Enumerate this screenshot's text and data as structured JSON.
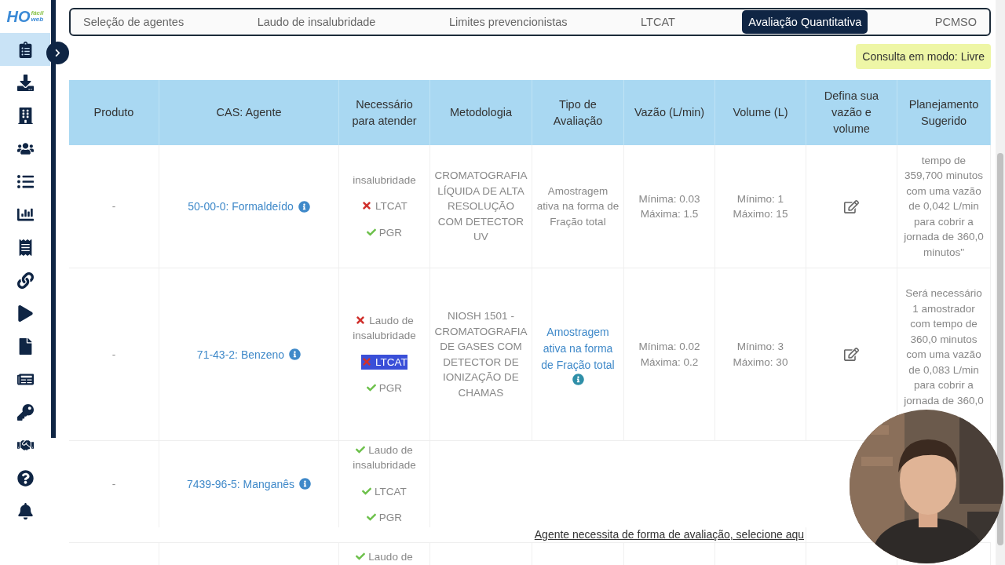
{
  "logo": {
    "mark": "HO",
    "line1": "fácil",
    "line2": "web"
  },
  "sidebar": {
    "items": [
      {
        "selected": true
      },
      {
        "selected": false
      },
      {
        "selected": false
      },
      {
        "selected": false
      },
      {
        "selected": false
      },
      {
        "selected": false
      },
      {
        "selected": false
      },
      {
        "selected": false
      },
      {
        "selected": false
      },
      {
        "selected": false
      },
      {
        "selected": false
      },
      {
        "selected": false
      },
      {
        "selected": false
      },
      {
        "selected": false
      },
      {
        "selected": false
      }
    ]
  },
  "tabs": [
    {
      "label": "Seleção de agentes",
      "selected": false
    },
    {
      "label": "Laudo de insalubridade",
      "selected": false
    },
    {
      "label": "Limites prevencionistas",
      "selected": false
    },
    {
      "label": "LTCAT",
      "selected": false
    },
    {
      "label": "Avaliação Quantitativa",
      "selected": true
    },
    {
      "label": "PCMSO",
      "selected": false
    }
  ],
  "mode_badge": "Consulta em modo: Livre",
  "table": {
    "columns": [
      "Produto",
      "CAS: Agente",
      "Necessário para atender",
      "Metodologia",
      "Tipo de Avaliação",
      "Vazão (L/min)",
      "Volume (L)",
      "Defina sua vazão e volume",
      "Planejamento Sugerido"
    ],
    "rows": [
      {
        "product": "-",
        "agent": "50-00-0: Formaldeído",
        "needs": [
          {
            "label": "insalubridade",
            "highlighted": false
          },
          {
            "label": "LTCAT",
            "met": false,
            "highlighted": false
          },
          {
            "label": "PGR",
            "met": true,
            "highlighted": false
          }
        ],
        "method": "CROMATOGRAFIA LÍQUIDA DE ALTA RESOLUÇÃO COM DETECTOR UV",
        "evaluation": {
          "kind": "text",
          "text": "Amostragem ativa na forma de Fração total"
        },
        "flow": [
          "Mínima: 0.03",
          "Máxima: 1.5"
        ],
        "volume": [
          "Mínimo: 1",
          "Máximo: 15"
        ],
        "planning": "tempo de 359,700 minutos com uma vazão de 0,042 L/min para cobrir a jornada de 360,0 minutos\""
      },
      {
        "product": "-",
        "agent": "71-43-2: Benzeno",
        "needs": [
          {
            "label": "Laudo de insalubridade",
            "met": false,
            "highlighted": false
          },
          {
            "label": "LTCAT",
            "met": false,
            "highlighted": true
          },
          {
            "label": "PGR",
            "met": true,
            "highlighted": false
          }
        ],
        "method": "NIOSH 1501 - CROMATOGRAFIA DE GASES COM DETECTOR DE IONIZAÇÃO DE CHAMAS",
        "evaluation": {
          "kind": "link",
          "text": "Amostragem ativa na forma de Fração total"
        },
        "flow": [
          "Mínima: 0.02",
          "Máxima: 0.2"
        ],
        "volume": [
          "Mínimo: 3",
          "Máximo: 30"
        ],
        "planning": "Será necessário 1 amostrador com tempo de 360,0 minutos com uma vazão de 0,083 L/min para cobrir a jornada de 360,0"
      },
      {
        "product": "-",
        "agent": "7439-96-5: Manganês",
        "needs": [
          {
            "label": "Laudo de insalubridade",
            "met": true,
            "highlighted": false
          },
          {
            "label": "LTCAT",
            "met": true,
            "highlighted": false
          },
          {
            "label": "PGR",
            "met": true,
            "highlighted": false
          }
        ],
        "notice": "Agente necessita de forma de avaliação, selecione aqu"
      },
      {
        "needs": [
          {
            "label": "Laudo de",
            "met": true,
            "highlighted": false
          }
        ]
      }
    ]
  }
}
